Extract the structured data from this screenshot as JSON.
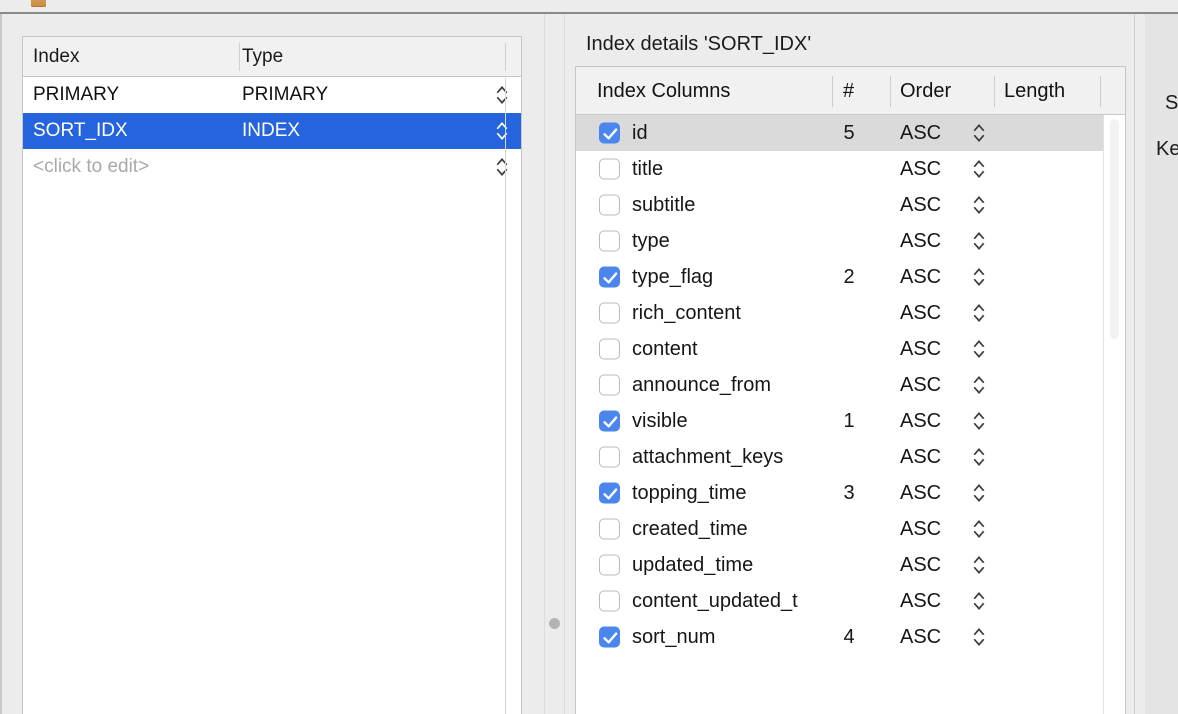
{
  "window": {
    "tab_icon": "table-tab-icon"
  },
  "index_list": {
    "columns": [
      "Index",
      "Type"
    ],
    "rows": [
      {
        "index": "PRIMARY",
        "type": "PRIMARY",
        "selected": false,
        "placeholder": false
      },
      {
        "index": "SORT_IDX",
        "type": "INDEX",
        "selected": true,
        "placeholder": false
      },
      {
        "index": "<click to edit>",
        "type": "",
        "selected": false,
        "placeholder": true
      }
    ],
    "stepper_icon": "stepper-up-down-icon",
    "selection_color": "#2564dd"
  },
  "details": {
    "title": "Index details 'SORT_IDX'",
    "columns": [
      "Index Columns",
      "#",
      "Order",
      "Length"
    ],
    "checkbox_color": "#4a86ee",
    "active_row_color": "#dadada",
    "rows": [
      {
        "name": "id",
        "checked": true,
        "seq": "5",
        "order": "ASC",
        "length": "",
        "active": true
      },
      {
        "name": "title",
        "checked": false,
        "seq": "",
        "order": "ASC",
        "length": "",
        "active": false
      },
      {
        "name": "subtitle",
        "checked": false,
        "seq": "",
        "order": "ASC",
        "length": "",
        "active": false
      },
      {
        "name": "type",
        "checked": false,
        "seq": "",
        "order": "ASC",
        "length": "",
        "active": false
      },
      {
        "name": "type_flag",
        "checked": true,
        "seq": "2",
        "order": "ASC",
        "length": "",
        "active": false
      },
      {
        "name": "rich_content",
        "checked": false,
        "seq": "",
        "order": "ASC",
        "length": "",
        "active": false
      },
      {
        "name": "content",
        "checked": false,
        "seq": "",
        "order": "ASC",
        "length": "",
        "active": false
      },
      {
        "name": "announce_from",
        "checked": false,
        "seq": "",
        "order": "ASC",
        "length": "",
        "active": false
      },
      {
        "name": "visible",
        "checked": true,
        "seq": "1",
        "order": "ASC",
        "length": "",
        "active": false
      },
      {
        "name": "attachment_keys",
        "checked": false,
        "seq": "",
        "order": "ASC",
        "length": "",
        "active": false
      },
      {
        "name": "topping_time",
        "checked": true,
        "seq": "3",
        "order": "ASC",
        "length": "",
        "active": false
      },
      {
        "name": "created_time",
        "checked": false,
        "seq": "",
        "order": "ASC",
        "length": "",
        "active": false
      },
      {
        "name": "updated_time",
        "checked": false,
        "seq": "",
        "order": "ASC",
        "length": "",
        "active": false
      },
      {
        "name": "content_updated_t",
        "checked": false,
        "seq": "",
        "order": "ASC",
        "length": "",
        "active": false
      },
      {
        "name": "sort_num",
        "checked": true,
        "seq": "4",
        "order": "ASC",
        "length": "",
        "active": false
      }
    ]
  },
  "right_panel": {
    "title_truncated": "S",
    "label_truncated": "Ke"
  }
}
